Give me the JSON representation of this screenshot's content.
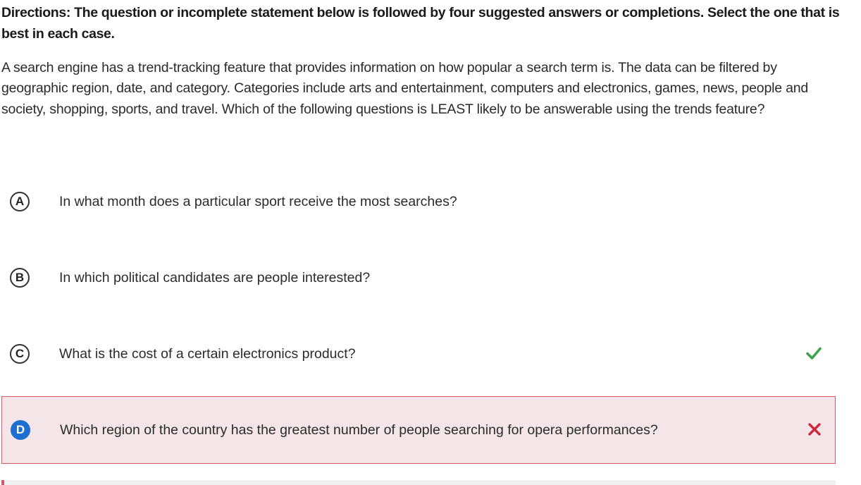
{
  "question": {
    "directions": "Directions: The question or incomplete statement below is followed by four suggested answers or completions. Select the one that is best in each case.",
    "stem": "A search engine has a trend-tracking feature that provides information on how popular a search term is. The data can be filtered by geographic region, date, and category. Categories include arts and entertainment, computers and electronics, games, news, people and society, shopping, sports, and travel. Which of the following questions is LEAST likely to be answerable using the trends feature?"
  },
  "choices": [
    {
      "letter": "A",
      "text": "In what month does a particular sport receive the most searches?"
    },
    {
      "letter": "B",
      "text": "In which political candidates are people interested?"
    },
    {
      "letter": "C",
      "text": "What is the cost of a certain electronics product?",
      "status": "correct",
      "icon": "check-icon"
    },
    {
      "letter": "D",
      "text": "Which region of the country has the greatest number of people searching for opera performances?",
      "status": "selected-incorrect",
      "icon": "x-icon"
    }
  ],
  "colors": {
    "correct": "#3aa54a",
    "incorrect": "#d0273e",
    "selected_bg": "#f4e6e8",
    "selected_border": "#d9576b",
    "selected_letter_bg": "#1f6fd1"
  }
}
